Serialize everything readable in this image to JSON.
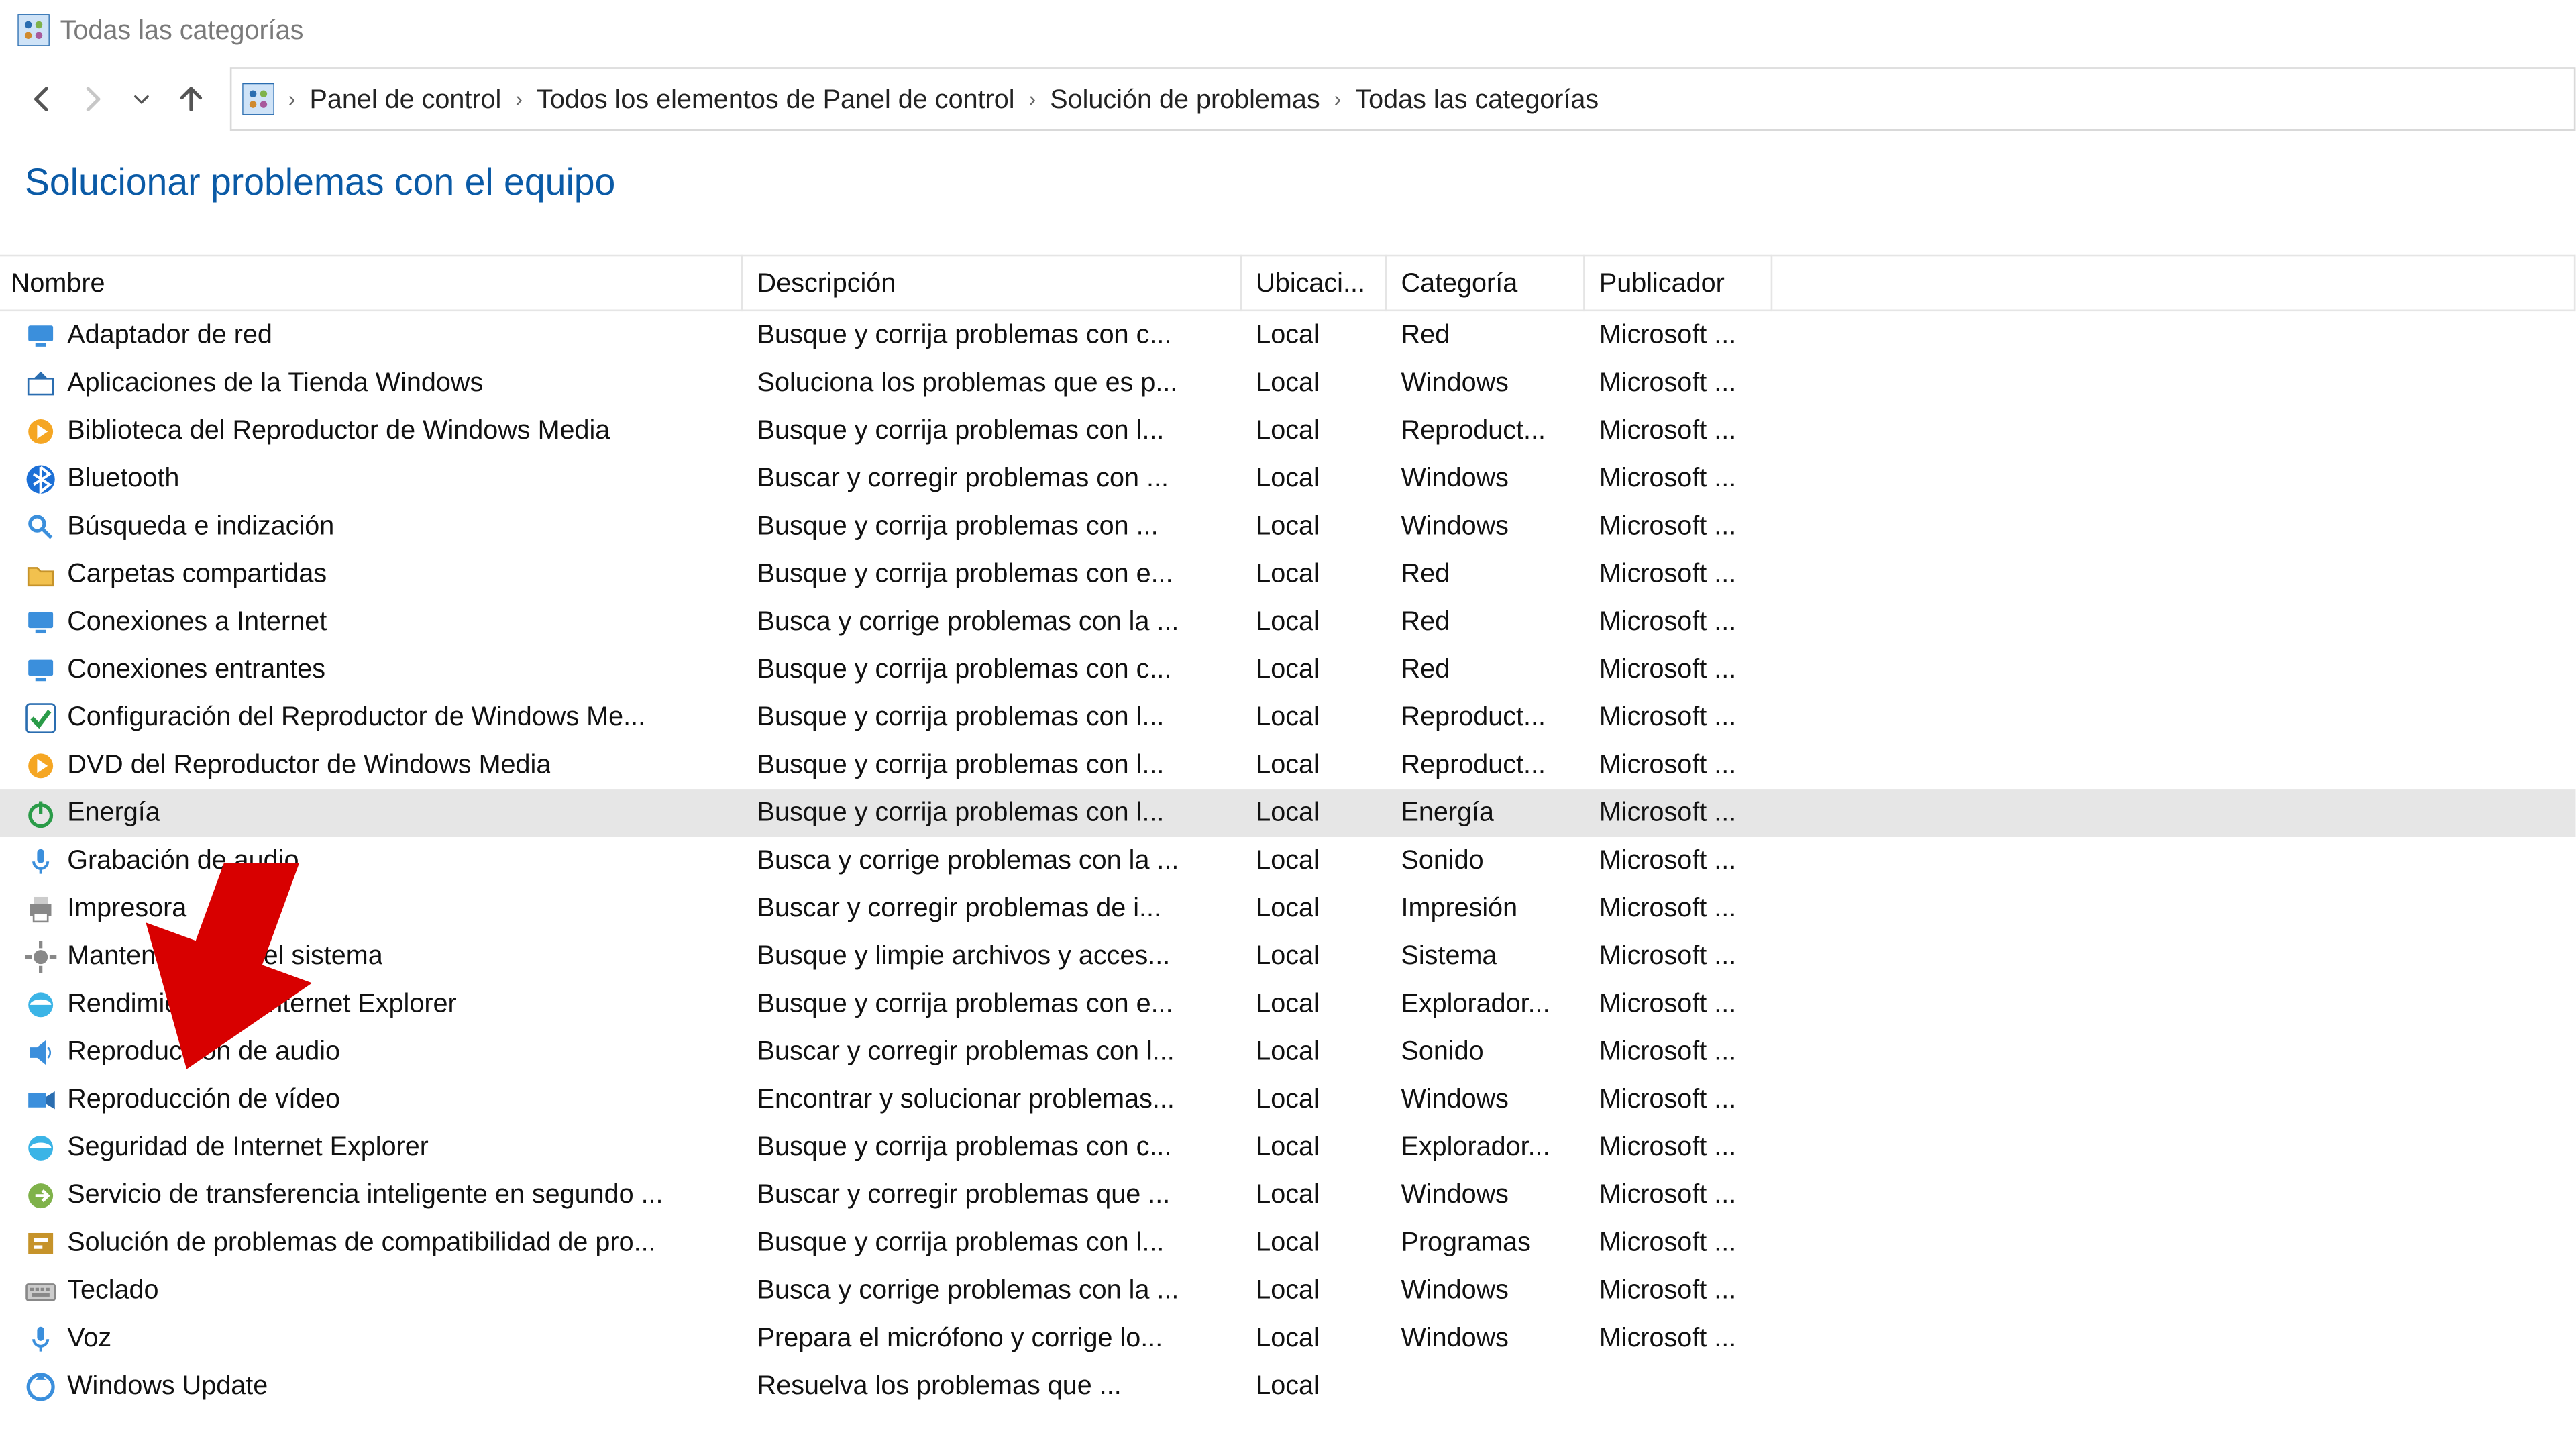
{
  "window_title": "Todas las categorías",
  "breadcrumb": [
    "Panel de control",
    "Todos los elementos de Panel de control",
    "Solución de problemas",
    "Todas las categorías"
  ],
  "page_heading": "Solucionar problemas con el equipo",
  "columns": {
    "name": "Nombre",
    "desc": "Descripción",
    "location": "Ubicaci...",
    "category": "Categoría",
    "publisher": "Publicador"
  },
  "selected_index": 10,
  "rows": [
    {
      "icon": "network",
      "name": "Adaptador de red",
      "desc": "Busque y corrija problemas con c...",
      "loc": "Local",
      "cat": "Red",
      "pub": "Microsoft ..."
    },
    {
      "icon": "store",
      "name": "Aplicaciones de la Tienda Windows",
      "desc": "Soluciona los problemas que es p...",
      "loc": "Local",
      "cat": "Windows",
      "pub": "Microsoft ..."
    },
    {
      "icon": "wmp",
      "name": "Biblioteca del Reproductor de Windows Media",
      "desc": "Busque y corrija problemas con l...",
      "loc": "Local",
      "cat": "Reproduct...",
      "pub": "Microsoft ..."
    },
    {
      "icon": "bluetooth",
      "name": "Bluetooth",
      "desc": "Buscar y corregir problemas con ...",
      "loc": "Local",
      "cat": "Windows",
      "pub": "Microsoft ..."
    },
    {
      "icon": "search",
      "name": "Búsqueda e indización",
      "desc": "Busque y corrija problemas con ...",
      "loc": "Local",
      "cat": "Windows",
      "pub": "Microsoft ..."
    },
    {
      "icon": "folder",
      "name": "Carpetas compartidas",
      "desc": "Busque y corrija problemas con e...",
      "loc": "Local",
      "cat": "Red",
      "pub": "Microsoft ..."
    },
    {
      "icon": "network",
      "name": "Conexiones a Internet",
      "desc": "Busca y corrige problemas con la ...",
      "loc": "Local",
      "cat": "Red",
      "pub": "Microsoft ..."
    },
    {
      "icon": "network",
      "name": "Conexiones entrantes",
      "desc": "Busque y corrija problemas con c...",
      "loc": "Local",
      "cat": "Red",
      "pub": "Microsoft ..."
    },
    {
      "icon": "check",
      "name": "Configuración del Reproductor de Windows Me...",
      "desc": "Busque y corrija problemas con l...",
      "loc": "Local",
      "cat": "Reproduct...",
      "pub": "Microsoft ..."
    },
    {
      "icon": "wmp",
      "name": "DVD del Reproductor de Windows Media",
      "desc": "Busque y corrija problemas con l...",
      "loc": "Local",
      "cat": "Reproduct...",
      "pub": "Microsoft ..."
    },
    {
      "icon": "power",
      "name": "Energía",
      "desc": "Busque y corrija problemas con l...",
      "loc": "Local",
      "cat": "Energía",
      "pub": "Microsoft ..."
    },
    {
      "icon": "mic",
      "name": "Grabación de audio",
      "desc": "Busca y corrige problemas con la ...",
      "loc": "Local",
      "cat": "Sonido",
      "pub": "Microsoft ..."
    },
    {
      "icon": "printer",
      "name": "Impresora",
      "desc": "Buscar y corregir problemas de i...",
      "loc": "Local",
      "cat": "Impresión",
      "pub": "Microsoft ..."
    },
    {
      "icon": "gear",
      "name": "Mantenimiento del sistema",
      "desc": "Busque y limpie archivos y acces...",
      "loc": "Local",
      "cat": "Sistema",
      "pub": "Microsoft ..."
    },
    {
      "icon": "ie",
      "name": "Rendimiento de Internet Explorer",
      "desc": "Busque y corrija problemas con e...",
      "loc": "Local",
      "cat": "Explorador...",
      "pub": "Microsoft ..."
    },
    {
      "icon": "speaker",
      "name": "Reproducción de audio",
      "desc": "Buscar y corregir problemas con l...",
      "loc": "Local",
      "cat": "Sonido",
      "pub": "Microsoft ..."
    },
    {
      "icon": "video",
      "name": "Reproducción de vídeo",
      "desc": "Encontrar y solucionar problemas...",
      "loc": "Local",
      "cat": "Windows",
      "pub": "Microsoft ..."
    },
    {
      "icon": "ie",
      "name": "Seguridad de Internet Explorer",
      "desc": "Busque y corrija problemas con c...",
      "loc": "Local",
      "cat": "Explorador...",
      "pub": "Microsoft ..."
    },
    {
      "icon": "transfer",
      "name": "Servicio de transferencia inteligente en segundo ...",
      "desc": "Buscar y corregir problemas que ...",
      "loc": "Local",
      "cat": "Windows",
      "pub": "Microsoft ..."
    },
    {
      "icon": "compat",
      "name": "Solución de problemas de compatibilidad de pro...",
      "desc": "Busque y corrija problemas con l...",
      "loc": "Local",
      "cat": "Programas",
      "pub": "Microsoft ..."
    },
    {
      "icon": "keyboard",
      "name": "Teclado",
      "desc": "Busca y corrige problemas con la ...",
      "loc": "Local",
      "cat": "Windows",
      "pub": "Microsoft ..."
    },
    {
      "icon": "mic",
      "name": "Voz",
      "desc": "Prepara el micrófono y corrige lo...",
      "loc": "Local",
      "cat": "Windows",
      "pub": "Microsoft ..."
    },
    {
      "icon": "update",
      "name": "Windows Update",
      "desc": "Resuelva los problemas que ...",
      "loc": "Local",
      "cat": "",
      "pub": ""
    }
  ]
}
